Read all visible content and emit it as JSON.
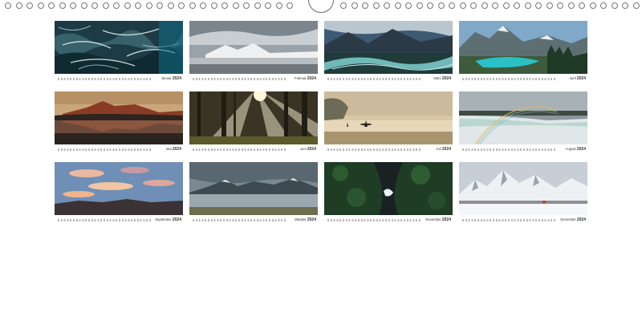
{
  "calendar": {
    "months": [
      {
        "name": "Januar",
        "year": "2024",
        "scene": "ocean-aerial-icon"
      },
      {
        "name": "Februar",
        "year": "2024",
        "scene": "snowy-plain-icon"
      },
      {
        "name": "März",
        "year": "2024",
        "scene": "mountain-river-icon"
      },
      {
        "name": "April",
        "year": "2024",
        "scene": "glacier-lake-icon"
      },
      {
        "name": "Mai",
        "year": "2024",
        "scene": "red-mountain-lake-icon"
      },
      {
        "name": "Juni",
        "year": "2024",
        "scene": "forest-sunbeams-icon"
      },
      {
        "name": "Juli",
        "year": "2024",
        "scene": "misty-beach-surfer-icon"
      },
      {
        "name": "August",
        "year": "2024",
        "scene": "waterfall-rainbow-icon"
      },
      {
        "name": "September",
        "year": "2024",
        "scene": "sunset-clouds-icon"
      },
      {
        "name": "Oktober",
        "year": "2024",
        "scene": "stormy-mountain-lake-icon"
      },
      {
        "name": "November",
        "year": "2024",
        "scene": "forest-river-aerial-icon"
      },
      {
        "name": "Dezember",
        "year": "2024",
        "scene": "snow-mountains-icon"
      }
    ]
  }
}
